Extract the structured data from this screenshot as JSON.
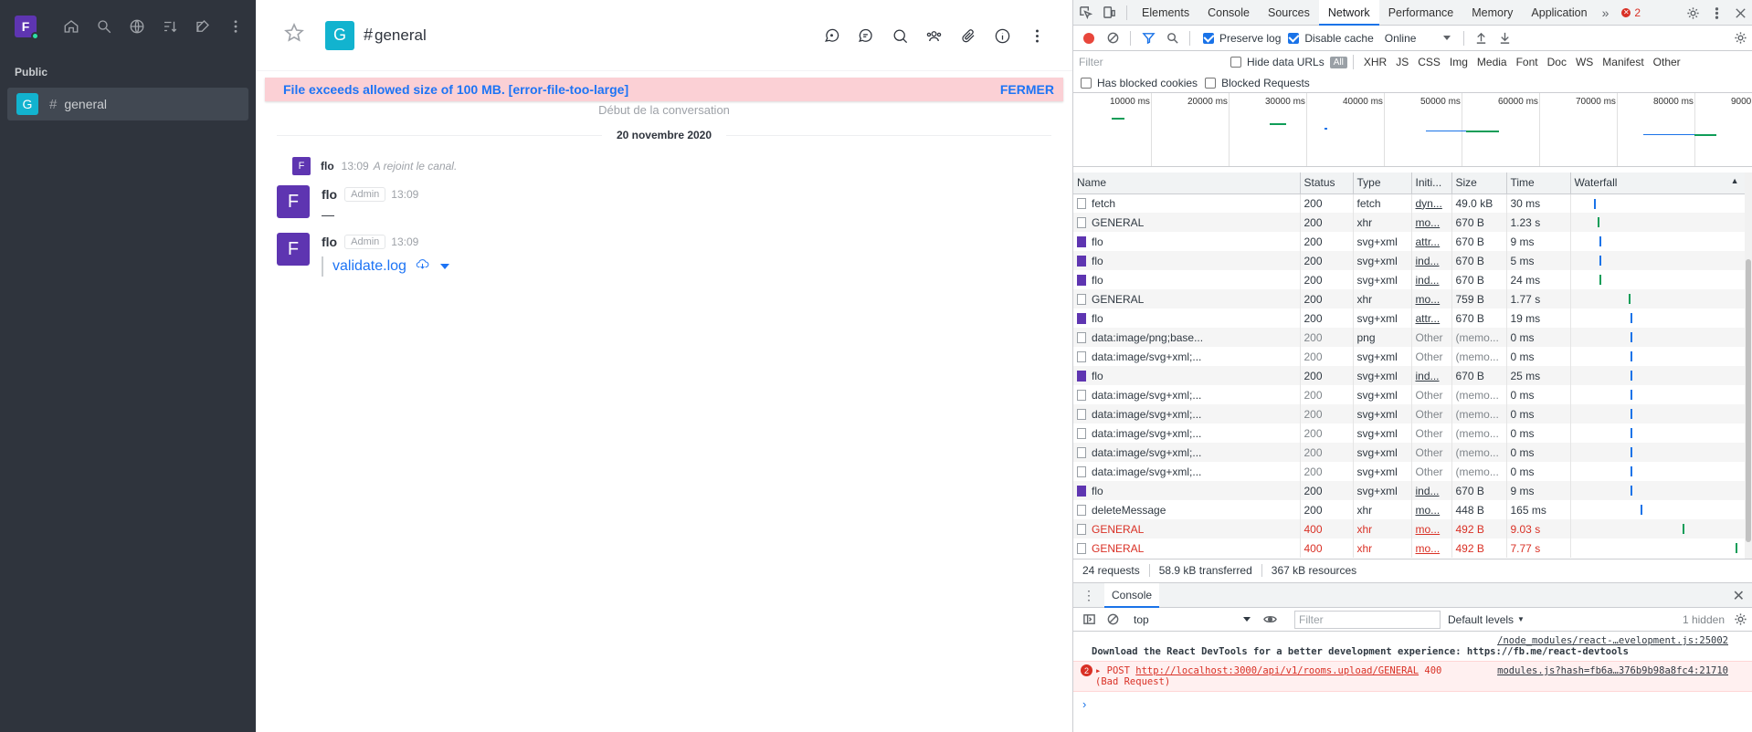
{
  "sidebar": {
    "user_initial": "F",
    "section_label": "Public",
    "room": {
      "initial": "G",
      "hash": "#",
      "name": "general"
    },
    "icons": [
      "home-icon",
      "search-icon",
      "directory-icon",
      "sort-icon",
      "create-new-icon",
      "more-kebab-icon"
    ]
  },
  "header": {
    "room_initial": "G",
    "hash": "#",
    "title": "general",
    "actions": [
      "discussion-icon",
      "threads-icon",
      "search-messages-icon",
      "members-icon",
      "files-icon",
      "room-info-icon",
      "more-kebab-icon"
    ]
  },
  "error_banner": {
    "text": "File exceeds allowed size of 100 MB. [error-file-too-large]",
    "close_label": "FERMER"
  },
  "chat": {
    "start_label": "Début de la conversation",
    "day_label": "20 novembre 2020",
    "system_message": {
      "initial": "F",
      "user": "flo",
      "time": "13:09",
      "text": "A rejoint le canal."
    },
    "messages": [
      {
        "initial": "F",
        "user": "flo",
        "role": "Admin",
        "time": "13:09",
        "text": "—"
      },
      {
        "initial": "F",
        "user": "flo",
        "role": "Admin",
        "time": "13:09",
        "attachment": "validate.log"
      }
    ]
  },
  "devtools": {
    "tabs": [
      "Elements",
      "Console",
      "Sources",
      "Network",
      "Performance",
      "Memory",
      "Application"
    ],
    "active_tab": "Network",
    "error_count": "2",
    "toolbar": {
      "preserve_log": "Preserve log",
      "disable_cache": "Disable cache",
      "throttle": "Online"
    },
    "filter": {
      "placeholder": "Filter",
      "hide_data_urls": "Hide data URLs",
      "all": "All",
      "types": [
        "XHR",
        "JS",
        "CSS",
        "Img",
        "Media",
        "Font",
        "Doc",
        "WS",
        "Manifest",
        "Other"
      ],
      "has_blocked_cookies": "Has blocked cookies",
      "blocked_requests": "Blocked Requests"
    },
    "overview_labels": [
      "10000 ms",
      "20000 ms",
      "30000 ms",
      "40000 ms",
      "50000 ms",
      "60000 ms",
      "70000 ms",
      "80000 ms",
      "9000"
    ],
    "columns": [
      "Name",
      "Status",
      "Type",
      "Initi...",
      "Size",
      "Time",
      "Waterfall"
    ],
    "rows": [
      {
        "name": "fetch",
        "status": "200",
        "type": "fetch",
        "initiator": "dyn...",
        "size": "49.0 kB",
        "time": "30 ms",
        "icon": "doc",
        "error": false,
        "wf": 0.12,
        "wf_color": "#1a73e8"
      },
      {
        "name": "GENERAL",
        "status": "200",
        "type": "xhr",
        "initiator": "mo...",
        "size": "670 B",
        "time": "1.23 s",
        "icon": "doc",
        "error": false,
        "wf": 0.14,
        "wf_color": "#0f9d58"
      },
      {
        "name": "flo",
        "status": "200",
        "type": "svg+xml",
        "initiator": "attr...",
        "size": "670 B",
        "time": "9 ms",
        "icon": "svg",
        "error": false,
        "wf": 0.15,
        "wf_color": "#1a73e8"
      },
      {
        "name": "flo",
        "status": "200",
        "type": "svg+xml",
        "initiator": "ind...",
        "size": "670 B",
        "time": "5 ms",
        "icon": "svg",
        "error": false,
        "wf": 0.15,
        "wf_color": "#1a73e8"
      },
      {
        "name": "flo",
        "status": "200",
        "type": "svg+xml",
        "initiator": "ind...",
        "size": "670 B",
        "time": "24 ms",
        "icon": "svg",
        "error": false,
        "wf": 0.15,
        "wf_color": "#0f9d58"
      },
      {
        "name": "GENERAL",
        "status": "200",
        "type": "xhr",
        "initiator": "mo...",
        "size": "759 B",
        "time": "1.77 s",
        "icon": "doc",
        "error": false,
        "wf": 0.33,
        "wf_color": "#0f9d58"
      },
      {
        "name": "flo",
        "status": "200",
        "type": "svg+xml",
        "initiator": "attr...",
        "size": "670 B",
        "time": "19 ms",
        "icon": "svg",
        "error": false,
        "wf": 0.34,
        "wf_color": "#1a73e8"
      },
      {
        "name": "data:image/png;base...",
        "status": "200",
        "type": "png",
        "initiator": "Other",
        "size": "(memo...",
        "time": "0 ms",
        "icon": "doc",
        "error": false,
        "gray": true,
        "wf": 0.34,
        "wf_color": "#1a73e8"
      },
      {
        "name": "data:image/svg+xml;...",
        "status": "200",
        "type": "svg+xml",
        "initiator": "Other",
        "size": "(memo...",
        "time": "0 ms",
        "icon": "doc",
        "error": false,
        "gray": true,
        "wf": 0.34,
        "wf_color": "#1a73e8"
      },
      {
        "name": "flo",
        "status": "200",
        "type": "svg+xml",
        "initiator": "ind...",
        "size": "670 B",
        "time": "25 ms",
        "icon": "svg",
        "error": false,
        "wf": 0.34,
        "wf_color": "#1a73e8"
      },
      {
        "name": "data:image/svg+xml;...",
        "status": "200",
        "type": "svg+xml",
        "initiator": "Other",
        "size": "(memo...",
        "time": "0 ms",
        "icon": "doc",
        "error": false,
        "gray": true,
        "wf": 0.34,
        "wf_color": "#1a73e8"
      },
      {
        "name": "data:image/svg+xml;...",
        "status": "200",
        "type": "svg+xml",
        "initiator": "Other",
        "size": "(memo...",
        "time": "0 ms",
        "icon": "doc",
        "error": false,
        "gray": true,
        "wf": 0.34,
        "wf_color": "#1a73e8"
      },
      {
        "name": "data:image/svg+xml;...",
        "status": "200",
        "type": "svg+xml",
        "initiator": "Other",
        "size": "(memo...",
        "time": "0 ms",
        "icon": "doc",
        "error": false,
        "gray": true,
        "wf": 0.34,
        "wf_color": "#1a73e8"
      },
      {
        "name": "data:image/svg+xml;...",
        "status": "200",
        "type": "svg+xml",
        "initiator": "Other",
        "size": "(memo...",
        "time": "0 ms",
        "icon": "doc",
        "error": false,
        "gray": true,
        "wf": 0.34,
        "wf_color": "#1a73e8"
      },
      {
        "name": "data:image/svg+xml;...",
        "status": "200",
        "type": "svg+xml",
        "initiator": "Other",
        "size": "(memo...",
        "time": "0 ms",
        "icon": "doc",
        "error": false,
        "gray": true,
        "wf": 0.34,
        "wf_color": "#1a73e8"
      },
      {
        "name": "flo",
        "status": "200",
        "type": "svg+xml",
        "initiator": "ind...",
        "size": "670 B",
        "time": "9 ms",
        "icon": "svg",
        "error": false,
        "wf": 0.34,
        "wf_color": "#1a73e8"
      },
      {
        "name": "deleteMessage",
        "status": "200",
        "type": "xhr",
        "initiator": "mo...",
        "size": "448 B",
        "time": "165 ms",
        "icon": "doc",
        "error": false,
        "wf": 0.4,
        "wf_color": "#1a73e8"
      },
      {
        "name": "GENERAL",
        "status": "400",
        "type": "xhr",
        "initiator": "mo...",
        "size": "492 B",
        "time": "9.03 s",
        "icon": "doc",
        "error": true,
        "wf": 0.66,
        "wf_color": "#0f9d58"
      },
      {
        "name": "GENERAL",
        "status": "400",
        "type": "xhr",
        "initiator": "mo...",
        "size": "492 B",
        "time": "7.77 s",
        "icon": "doc",
        "error": true,
        "wf": 0.98,
        "wf_color": "#0f9d58"
      }
    ],
    "summary": [
      "24 requests",
      "58.9 kB transferred",
      "367 kB resources"
    ],
    "console": {
      "tab_label": "Console",
      "context": "top",
      "filter_placeholder": "Filter",
      "levels": "Default levels",
      "hidden": "1 hidden",
      "lines": [
        {
          "text": "Download the React DevTools for a better development experience: https://fb.me/react-devtools",
          "source": "/node_modules/react-…evelopment.js:25002"
        },
        {
          "badge": "2",
          "method": "POST",
          "url": "http://localhost:3000/api/v1/rooms.upload/GENERAL",
          "status": "400",
          "status_text": "(Bad Request)",
          "source": "modules.js?hash=fb6a…376b9b98a8fc4:21710"
        }
      ],
      "prompt": "›"
    }
  }
}
